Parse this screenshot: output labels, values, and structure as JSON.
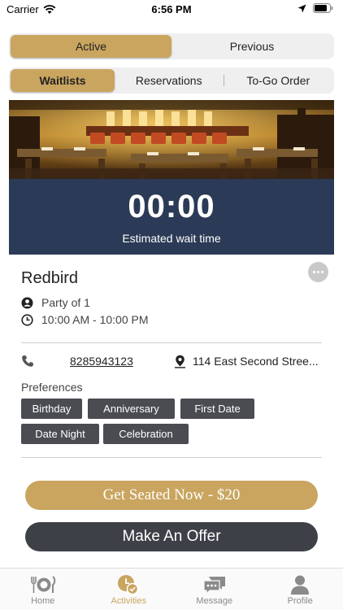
{
  "status_bar": {
    "carrier": "Carrier",
    "time": "6:56 PM"
  },
  "segment_top": {
    "options": [
      "Active",
      "Previous"
    ],
    "selected": "Active"
  },
  "segment_sub": {
    "options": [
      "Waitlists",
      "Reservations",
      "To-Go Order"
    ],
    "selected": "Waitlists"
  },
  "timer": {
    "value": "00:00",
    "label": "Estimated wait time"
  },
  "restaurant": {
    "name": "Redbird",
    "party": "Party of 1",
    "hours": "10:00 AM - 10:00 PM",
    "phone": "8285943123",
    "address": "114 East Second Stree..."
  },
  "preferences": {
    "title": "Preferences",
    "chips": [
      "Birthday",
      "Anniversary",
      "First Date",
      "Date Night",
      "Celebration"
    ]
  },
  "actions": {
    "seat_now": "Get Seated Now - $20",
    "offer": "Make An Offer"
  },
  "tabbar": {
    "items": [
      {
        "label": "Home",
        "icon": "dining-icon"
      },
      {
        "label": "Activities",
        "icon": "activities-clock-icon"
      },
      {
        "label": "Message",
        "icon": "message-icon"
      },
      {
        "label": "Profile",
        "icon": "profile-icon"
      }
    ],
    "active": "Activities"
  },
  "colors": {
    "accent": "#c9a55f",
    "panel": "#2b3a56",
    "chip": "#4a4c52",
    "offer": "#3e4047"
  }
}
